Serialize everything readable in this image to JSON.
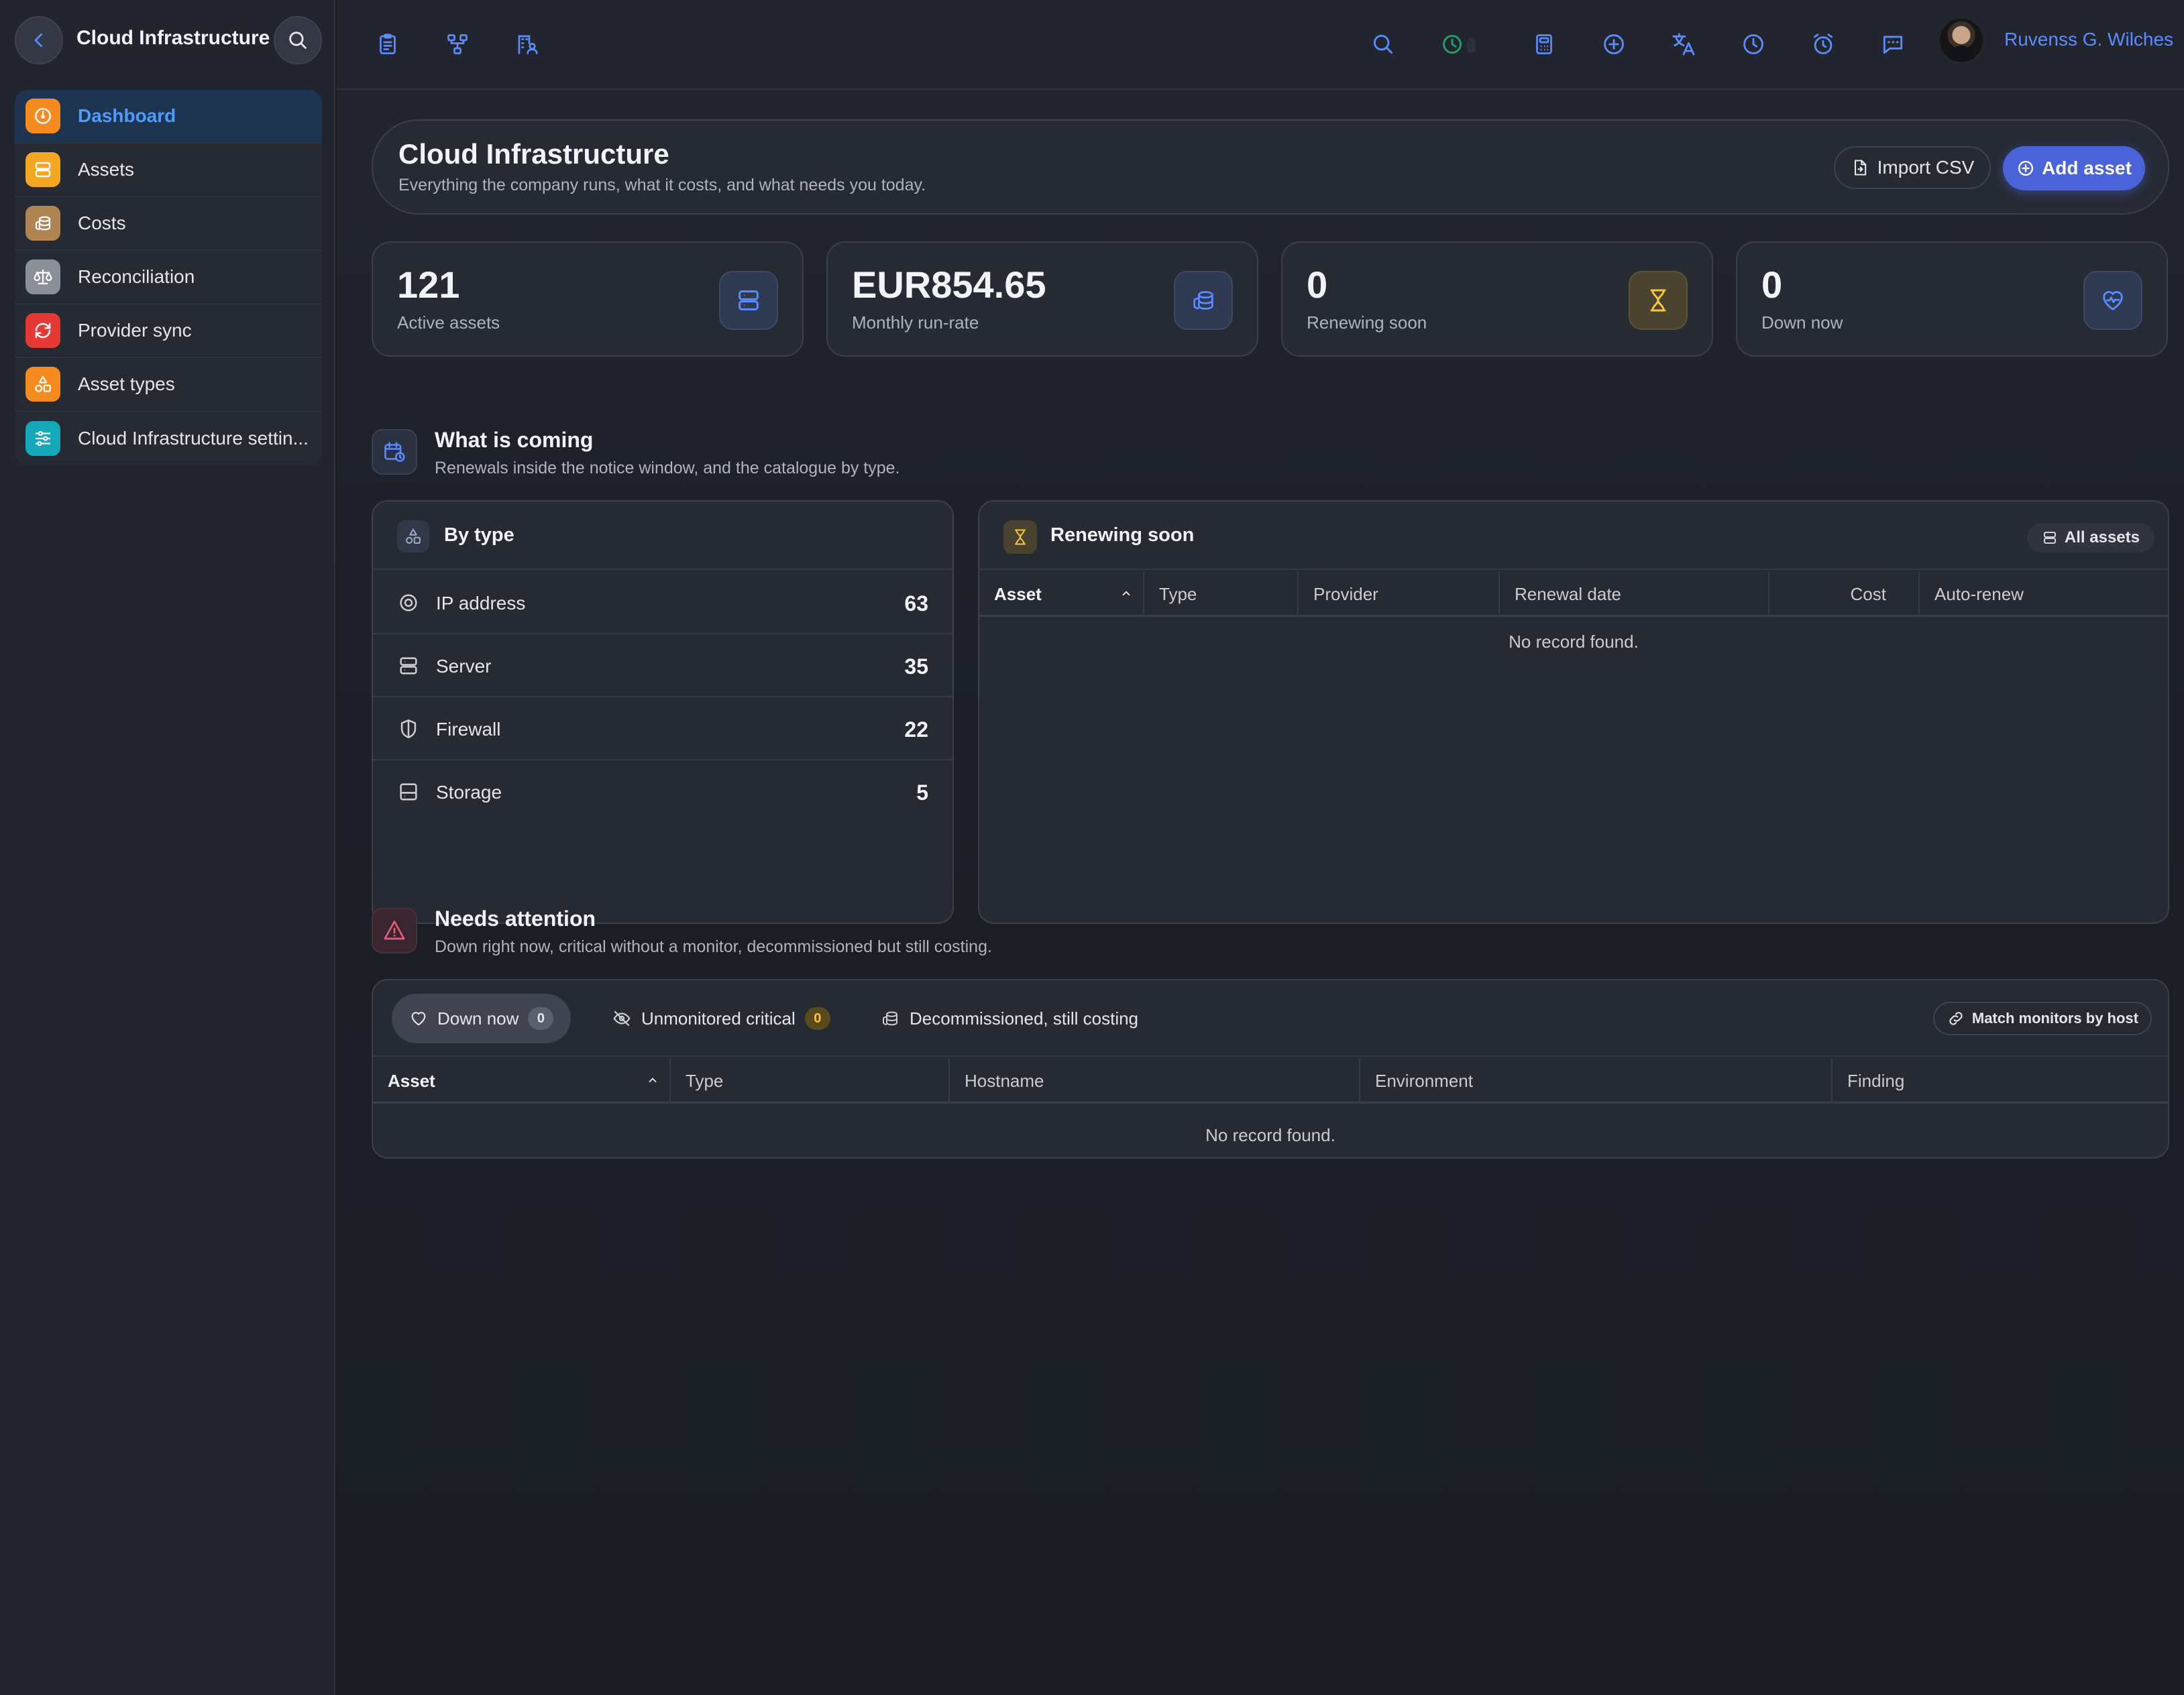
{
  "sidebar": {
    "title": "Cloud Infrastructure",
    "items": [
      {
        "label": "Dashboard",
        "icon": "gauge-icon",
        "color": "#f58a1f",
        "active": true
      },
      {
        "label": "Assets",
        "icon": "server-icon",
        "color": "#f5a623"
      },
      {
        "label": "Costs",
        "icon": "coins-icon",
        "color": "#b08552"
      },
      {
        "label": "Reconciliation",
        "icon": "scale-icon",
        "color": "#8a8f99"
      },
      {
        "label": "Provider sync",
        "icon": "sync-icon",
        "color": "#e53935"
      },
      {
        "label": "Asset types",
        "icon": "shapes-icon",
        "color": "#f58a1f"
      },
      {
        "label": "Cloud Infrastructure settin...",
        "icon": "sliders-icon",
        "color": "#14a8b8"
      }
    ]
  },
  "topbar": {
    "user_name": "Ruvenss G. Wilches",
    "left_icons": [
      "clipboard-icon",
      "hierarchy-icon",
      "building-user-icon"
    ],
    "right_icons": [
      "search-icon",
      "timer-icon",
      "calculator-icon",
      "plus-circle-icon",
      "translate-icon",
      "clock-icon",
      "alarm-icon",
      "chat-icon"
    ]
  },
  "hero": {
    "title": "Cloud Infrastructure",
    "subtitle": "Everything the company runs, what it costs, and what needs you today.",
    "import_label": "Import CSV",
    "add_label": "Add asset"
  },
  "stats": [
    {
      "value": "121",
      "label": "Active assets",
      "icon": "server-icon"
    },
    {
      "value": "EUR854.65",
      "label": "Monthly run-rate",
      "icon": "coins-icon"
    },
    {
      "value": "0",
      "label": "Renewing soon",
      "icon": "hourglass-icon"
    },
    {
      "value": "0",
      "label": "Down now",
      "icon": "heart-pulse-icon"
    }
  ],
  "coming": {
    "title": "What is coming",
    "subtitle": "Renewals inside the notice window, and the catalogue by type."
  },
  "by_type": {
    "title": "By type",
    "rows": [
      {
        "label": "IP address",
        "count": "63",
        "icon": "target-icon"
      },
      {
        "label": "Server",
        "count": "35",
        "icon": "server-icon"
      },
      {
        "label": "Firewall",
        "count": "22",
        "icon": "shield-icon"
      },
      {
        "label": "Storage",
        "count": "5",
        "icon": "storage-icon"
      }
    ]
  },
  "renewing": {
    "title": "Renewing soon",
    "all_label": "All assets",
    "columns": [
      "Asset",
      "Type",
      "Provider",
      "Renewal date",
      "Cost",
      "Auto-renew"
    ],
    "empty": "No record found."
  },
  "attention": {
    "title": "Needs attention",
    "subtitle": "Down right now, critical without a monitor, decommissioned but still costing.",
    "tabs": [
      {
        "label": "Down now",
        "badge": "0"
      },
      {
        "label": "Unmonitored critical",
        "badge": "0"
      },
      {
        "label": "Decommissioned, still costing"
      }
    ],
    "match_label": "Match monitors by host",
    "columns": [
      "Asset",
      "Type",
      "Hostname",
      "Environment",
      "Finding"
    ],
    "empty": "No record found."
  }
}
